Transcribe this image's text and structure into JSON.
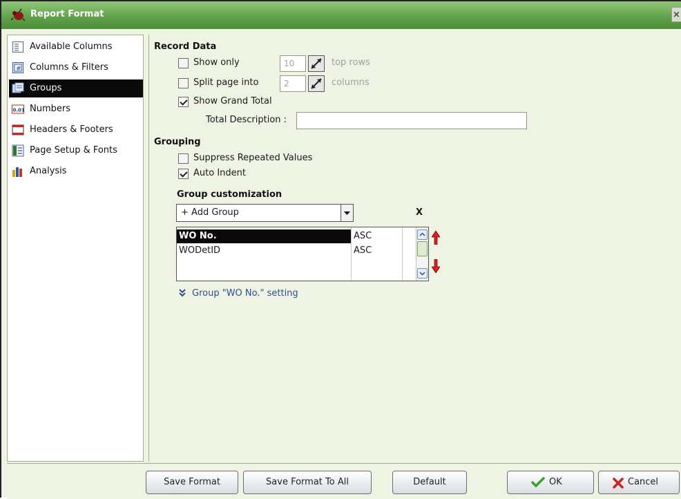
{
  "window": {
    "title": "Report Format",
    "close_glyph": "×"
  },
  "sidebar": {
    "items": [
      {
        "label": "Available Columns",
        "icon": "columns-list-icon"
      },
      {
        "label": "Columns & Filters",
        "icon": "filter-icon"
      },
      {
        "label": "Groups",
        "icon": "groups-icon",
        "active": true
      },
      {
        "label": "Numbers",
        "icon": "numbers-icon",
        "icon_text": "0.01"
      },
      {
        "label": "Headers & Footers",
        "icon": "header-footer-icon"
      },
      {
        "label": "Page Setup & Fonts",
        "icon": "page-setup-icon"
      },
      {
        "label": "Analysis",
        "icon": "analysis-chart-icon"
      }
    ]
  },
  "record_data": {
    "title": "Record Data",
    "show_only": {
      "label": "Show only",
      "checked": false,
      "value": "10",
      "suffix": "top rows"
    },
    "split_page": {
      "label": "Split page into",
      "checked": false,
      "value": "2",
      "suffix": "columns"
    },
    "grand_total": {
      "label": "Show Grand Total",
      "checked": true
    },
    "total_description": {
      "label": "Total Description :",
      "value": ""
    }
  },
  "grouping": {
    "title": "Grouping",
    "suppress": {
      "label": "Suppress Repeated Values",
      "checked": false
    },
    "auto_indent": {
      "label": "Auto Indent",
      "checked": true
    }
  },
  "group_customization": {
    "title": "Group customization",
    "add_group": "+ Add Group",
    "remove_label": "X",
    "groups": [
      {
        "name": "WO No.",
        "order": "ASC",
        "selected": true
      },
      {
        "name": "WODetID",
        "order": "ASC",
        "selected": false
      }
    ],
    "setting_link": "Group \"WO No.\" setting"
  },
  "buttons": {
    "save_format": "Save Format",
    "save_format_all": "Save Format To All",
    "default": "Default",
    "ok": "OK",
    "cancel": "Cancel"
  },
  "colors": {
    "titlebar": "#5ea048",
    "panel_bg": "#eef3e4",
    "arrow_red": "#d81f1f",
    "ok_green": "#3aa12a",
    "cancel_red": "#cc2222"
  }
}
